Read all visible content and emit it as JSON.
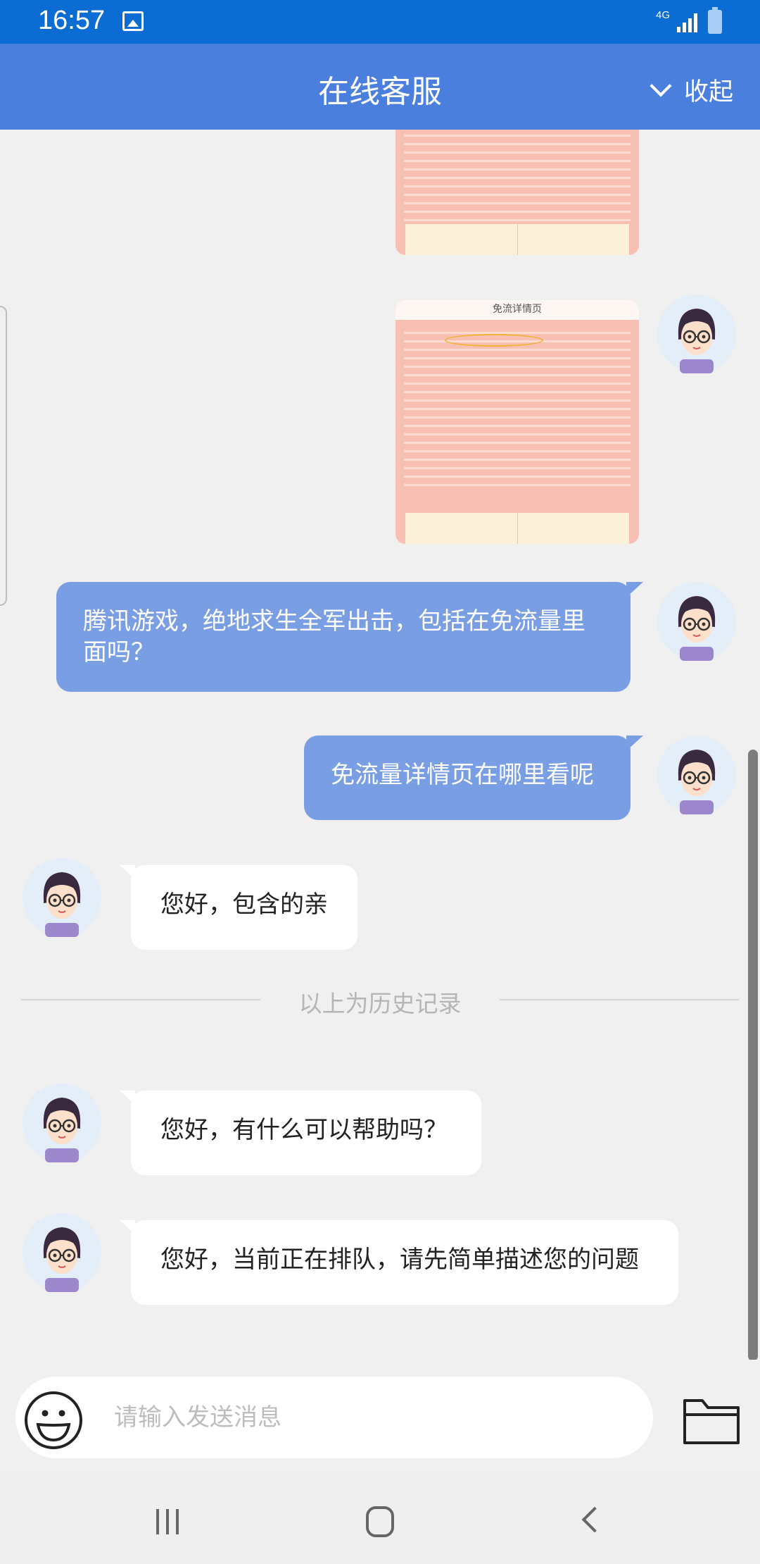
{
  "status_bar": {
    "time": "16:57",
    "network": "4G",
    "icons": [
      "image-icon",
      "signal-icon",
      "battery-icon"
    ]
  },
  "header": {
    "title": "在线客服",
    "collapse_label": "收起",
    "collapse_icon": "chevron-down-icon",
    "background": "#4a7fde"
  },
  "messages": [
    {
      "side": "right",
      "type": "image",
      "caption": ""
    },
    {
      "side": "right",
      "type": "image",
      "caption": "免流详情页"
    },
    {
      "side": "right",
      "type": "text",
      "text": "腾讯游戏，绝地求生全军出击，包括在免流量里面吗？"
    },
    {
      "side": "right",
      "type": "text",
      "text": "免流量详情页在哪里看呢"
    },
    {
      "side": "left",
      "type": "text",
      "text": "您好，包含的亲"
    },
    {
      "side": "left",
      "type": "text",
      "text": "您好，有什么可以帮助吗？"
    },
    {
      "side": "left",
      "type": "text",
      "text": "您好，当前正在排队，请先简单描述您的问题"
    }
  ],
  "history_divider": "以上为历史记录",
  "input": {
    "placeholder": "请输入发送消息",
    "value": "",
    "emoji_icon": "emoji-icon",
    "folder_icon": "folder-icon"
  },
  "nav_bar": {
    "icons": [
      "recent-apps-icon",
      "home-icon",
      "back-icon"
    ]
  },
  "colors": {
    "status_bar": "#0b6cd4",
    "outgoing_bubble": "#7a9ee3",
    "incoming_bubble": "#ffffff",
    "chat_background": "#f0f0f0"
  }
}
